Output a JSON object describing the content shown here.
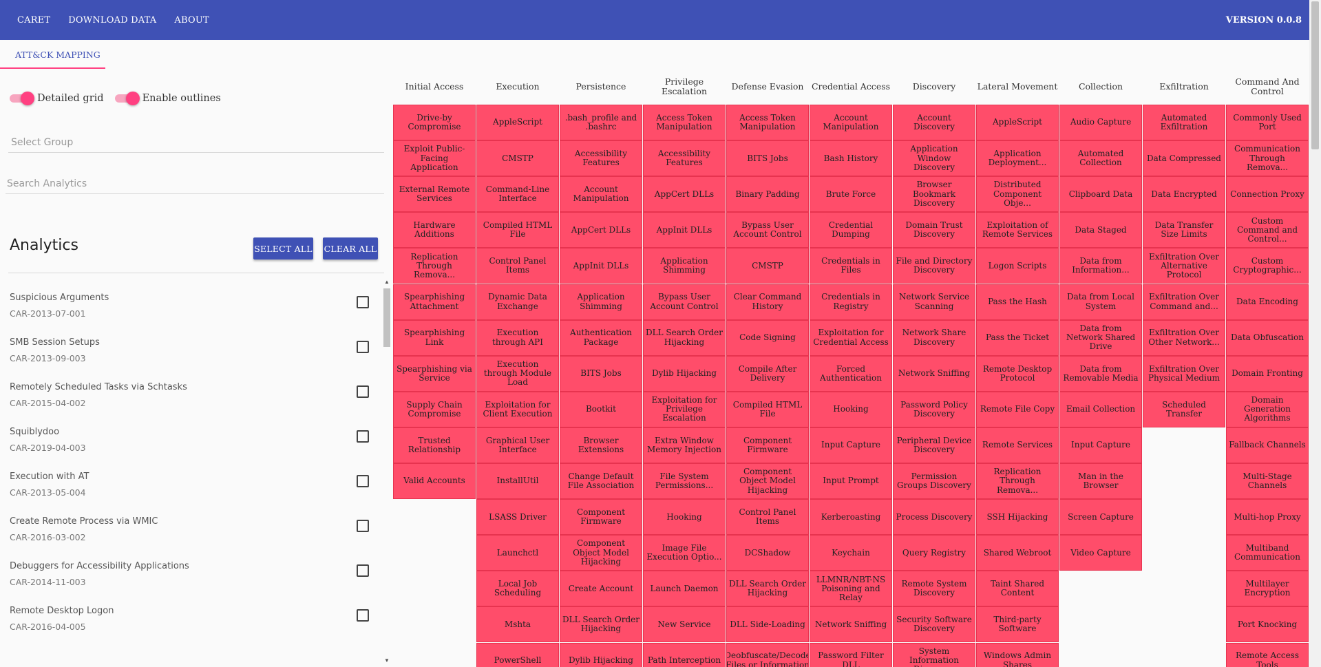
{
  "appbar": {
    "nav": [
      "CARET",
      "DOWNLOAD DATA",
      "ABOUT"
    ],
    "version": "VERSION 0.0.8"
  },
  "tab": {
    "label": "ATT&CK MAPPING"
  },
  "toggles": {
    "detailed_grid": {
      "label": "Detailed grid",
      "on": true
    },
    "enable_outlines": {
      "label": "Enable outlines",
      "on": true
    }
  },
  "select_group": {
    "placeholder": "Select Group"
  },
  "search_analytics": {
    "placeholder": "Search Analytics"
  },
  "analytics": {
    "title": "Analytics",
    "select_all": "SELECT ALL",
    "clear_all": "CLEAR ALL",
    "items": [
      {
        "name": "Suspicious Arguments",
        "id": "CAR-2013-07-001"
      },
      {
        "name": "SMB Session Setups",
        "id": "CAR-2013-09-003"
      },
      {
        "name": "Remotely Scheduled Tasks via Schtasks",
        "id": "CAR-2015-04-002"
      },
      {
        "name": "Squiblydoo",
        "id": "CAR-2019-04-003"
      },
      {
        "name": "Execution with AT",
        "id": "CAR-2013-05-004"
      },
      {
        "name": "Create Remote Process via WMIC",
        "id": "CAR-2016-03-002"
      },
      {
        "name": "Debuggers for Accessibility Applications",
        "id": "CAR-2014-11-003"
      },
      {
        "name": "Remote Desktop Logon",
        "id": "CAR-2016-04-005"
      }
    ]
  },
  "matrix": {
    "cell_color": "#ff4d6a",
    "columns": [
      {
        "header": "Initial Access",
        "cells": [
          "Drive-by Compromise",
          "Exploit Public-Facing Application",
          "External Remote Services",
          "Hardware Additions",
          "Replication Through Remova...",
          "Spearphishing Attachment",
          "Spearphishing Link",
          "Spearphishing via Service",
          "Supply Chain Compromise",
          "Trusted Relationship",
          "Valid Accounts"
        ]
      },
      {
        "header": "Execution",
        "cells": [
          "AppleScript",
          "CMSTP",
          "Command-Line Interface",
          "Compiled HTML File",
          "Control Panel Items",
          "Dynamic Data Exchange",
          "Execution through API",
          "Execution through Module Load",
          "Exploitation for Client Execution",
          "Graphical User Interface",
          "InstallUtil",
          "LSASS Driver",
          "Launchctl",
          "Local Job Scheduling",
          "Mshta",
          "PowerShell"
        ]
      },
      {
        "header": "Persistence",
        "cells": [
          ".bash_profile and .bashrc",
          "Accessibility Features",
          "Account Manipulation",
          "AppCert DLLs",
          "AppInit DLLs",
          "Application Shimming",
          "Authentication Package",
          "BITS Jobs",
          "Bootkit",
          "Browser Extensions",
          "Change Default File Association",
          "Component Firmware",
          "Component Object Model Hijacking",
          "Create Account",
          "DLL Search Order Hijacking",
          "Dylib Hijacking"
        ]
      },
      {
        "header": "Privilege Escalation",
        "cells": [
          "Access Token Manipulation",
          "Accessibility Features",
          "AppCert DLLs",
          "AppInit DLLs",
          "Application Shimming",
          "Bypass User Account Control",
          "DLL Search Order Hijacking",
          "Dylib Hijacking",
          "Exploitation for Privilege Escalation",
          "Extra Window Memory Injection",
          "File System Permissions...",
          "Hooking",
          "Image File Execution Optio...",
          "Launch Daemon",
          "New Service",
          "Path Interception"
        ]
      },
      {
        "header": "Defense Evasion",
        "cells": [
          "Access Token Manipulation",
          "BITS Jobs",
          "Binary Padding",
          "Bypass User Account Control",
          "CMSTP",
          "Clear Command History",
          "Code Signing",
          "Compile After Delivery",
          "Compiled HTML File",
          "Component Firmware",
          "Component Object Model Hijacking",
          "Control Panel Items",
          "DCShadow",
          "DLL Search Order Hijacking",
          "DLL Side-Loading",
          "Deobfuscate/Decode Files or Information"
        ]
      },
      {
        "header": "Credential Access",
        "cells": [
          "Account Manipulation",
          "Bash History",
          "Brute Force",
          "Credential Dumping",
          "Credentials in Files",
          "Credentials in Registry",
          "Exploitation for Credential Access",
          "Forced Authentication",
          "Hooking",
          "Input Capture",
          "Input Prompt",
          "Kerberoasting",
          "Keychain",
          "LLMNR/NBT-NS Poisoning and Relay",
          "Network Sniffing",
          "Password Filter DLL"
        ]
      },
      {
        "header": "Discovery",
        "cells": [
          "Account Discovery",
          "Application Window Discovery",
          "Browser Bookmark Discovery",
          "Domain Trust Discovery",
          "File and Directory Discovery",
          "Network Service Scanning",
          "Network Share Discovery",
          "Network Sniffing",
          "Password Policy Discovery",
          "Peripheral Device Discovery",
          "Permission Groups Discovery",
          "Process Discovery",
          "Query Registry",
          "Remote System Discovery",
          "Security Software Discovery",
          "System Information Discovery"
        ]
      },
      {
        "header": "Lateral Movement",
        "cells": [
          "AppleScript",
          "Application Deployment...",
          "Distributed Component Obje...",
          "Exploitation of Remote Services",
          "Logon Scripts",
          "Pass the Hash",
          "Pass the Ticket",
          "Remote Desktop Protocol",
          "Remote File Copy",
          "Remote Services",
          "Replication Through Remova...",
          "SSH Hijacking",
          "Shared Webroot",
          "Taint Shared Content",
          "Third-party Software",
          "Windows Admin Shares"
        ]
      },
      {
        "header": "Collection",
        "cells": [
          "Audio Capture",
          "Automated Collection",
          "Clipboard Data",
          "Data Staged",
          "Data from Information...",
          "Data from Local System",
          "Data from Network Shared Drive",
          "Data from Removable Media",
          "Email Collection",
          "Input Capture",
          "Man in the Browser",
          "Screen Capture",
          "Video Capture"
        ]
      },
      {
        "header": "Exfiltration",
        "cells": [
          "Automated Exfiltration",
          "Data Compressed",
          "Data Encrypted",
          "Data Transfer Size Limits",
          "Exfiltration Over Alternative Protocol",
          "Exfiltration Over Command and...",
          "Exfiltration Over Other Network...",
          "Exfiltration Over Physical Medium",
          "Scheduled Transfer"
        ]
      },
      {
        "header": "Command And Control",
        "cells": [
          "Commonly Used Port",
          "Communication Through Remova...",
          "Connection Proxy",
          "Custom Command and Control...",
          "Custom Cryptographic...",
          "Data Encoding",
          "Data Obfuscation",
          "Domain Fronting",
          "Domain Generation Algorithms",
          "Fallback Channels",
          "Multi-Stage Channels",
          "Multi-hop Proxy",
          "Multiband Communication",
          "Multilayer Encryption",
          "Port Knocking",
          "Remote Access Tools"
        ]
      }
    ]
  }
}
